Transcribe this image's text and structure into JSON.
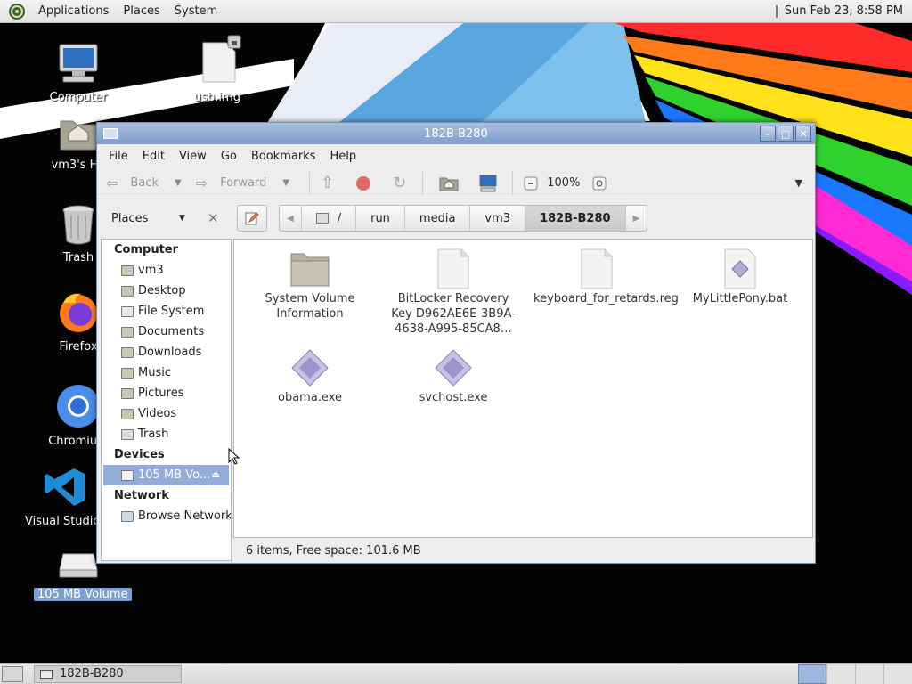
{
  "top_panel": {
    "menus": [
      "Applications",
      "Places",
      "System"
    ],
    "clock": "Sun Feb 23,  8:58 PM"
  },
  "desktop_icons": [
    {
      "label": "Computer",
      "icon": "computer-icon"
    },
    {
      "label": "usb.img",
      "icon": "file-icon"
    },
    {
      "label": "vm3's Ho",
      "icon": "home-folder-icon"
    },
    {
      "label": "Trash",
      "icon": "trash-icon"
    },
    {
      "label": "Firefox",
      "icon": "firefox-icon"
    },
    {
      "label": "Chromium",
      "icon": "chromium-icon"
    },
    {
      "label": "Visual Studio C",
      "icon": "vscode-icon"
    },
    {
      "label": "105 MB Volume",
      "icon": "drive-icon",
      "selected": true
    }
  ],
  "window": {
    "title": "182B-B280",
    "menu": [
      "File",
      "Edit",
      "View",
      "Go",
      "Bookmarks",
      "Help"
    ],
    "toolbar": {
      "back": "Back",
      "forward": "Forward",
      "zoom": "100%"
    },
    "places_label": "Places",
    "breadcrumb": [
      "/",
      "run",
      "media",
      "vm3",
      "182B-B280"
    ],
    "sidebar": {
      "computer_header": "Computer",
      "computer_items": [
        "vm3",
        "Desktop",
        "File System",
        "Documents",
        "Downloads",
        "Music",
        "Pictures",
        "Videos",
        "Trash"
      ],
      "devices_header": "Devices",
      "device_item": "105 MB Vo...",
      "network_header": "Network",
      "network_item": "Browse Network"
    },
    "files": [
      {
        "name": "System Volume Information",
        "icon": "folder-icon"
      },
      {
        "name": "BitLocker Recovery Key D962AE6E-3B9A-4638-A995-85CA8…",
        "icon": "document-icon"
      },
      {
        "name": "keyboard_for_retards.reg",
        "icon": "document-icon"
      },
      {
        "name": "MyLittlePony.bat",
        "icon": "script-icon"
      },
      {
        "name": "obama.exe",
        "icon": "executable-icon"
      },
      {
        "name": "svchost.exe",
        "icon": "executable-icon"
      }
    ],
    "status": "6 items, Free space: 101.6 MB"
  },
  "bottom_panel": {
    "task_label": "182B-B280"
  }
}
